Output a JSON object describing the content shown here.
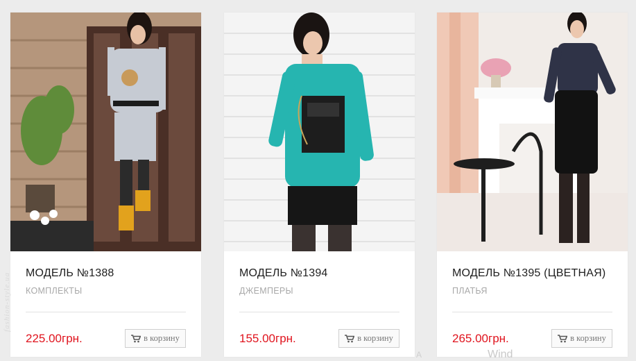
{
  "products": [
    {
      "title": "МОДЕЛЬ №1388",
      "category": "КОМПЛЕКТЫ",
      "price": "225.00грн.",
      "cart_label": "в корзину"
    },
    {
      "title": "МОДЕЛЬ №1394",
      "category": "ДЖЕМПЕРЫ",
      "price": "155.00грн.",
      "cart_label": "в корзину"
    },
    {
      "title": "МОДЕЛЬ №1395 (ЦВЕТНАЯ)",
      "category": "ПЛАТЬЯ",
      "price": "265.00грн.",
      "cart_label": "в корзину"
    }
  ],
  "side_watermark": "fashion-style.ua",
  "bottom_watermark": "Wind",
  "bottom_watermark_small": "A",
  "colors": {
    "price": "#e0141e",
    "background": "#ececec",
    "card": "#ffffff"
  },
  "icons": {
    "cart": "cart-icon"
  }
}
